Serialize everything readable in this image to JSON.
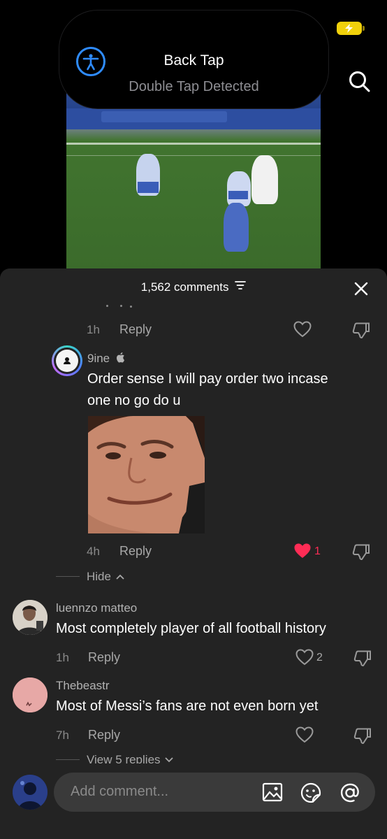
{
  "status": {
    "battery": "charging"
  },
  "notification": {
    "title": "Back Tap",
    "subtitle": "Double Tap Detected"
  },
  "comments_sheet": {
    "header": "1,562 comments",
    "comments": [
      {
        "time": "1h",
        "reply_label": "Reply"
      },
      {
        "user": "9ine",
        "text_line1": "Order sense I will pay order two incase",
        "text_line2": "one no go do u",
        "time": "4h",
        "reply_label": "Reply",
        "likes": "1",
        "liked": true
      },
      {
        "hide_label": "Hide"
      },
      {
        "user": "luennzo matteo",
        "text": "Most completely player of all football history",
        "time": "1h",
        "reply_label": "Reply",
        "likes": "2"
      },
      {
        "user": "Thebeastr",
        "text": "Most of Messi’s fans are not even born yet",
        "time": "7h",
        "reply_label": "Reply",
        "view_replies": "View 5 replies"
      }
    ]
  },
  "input": {
    "placeholder": "Add comment..."
  },
  "colors": {
    "accent_blue": "#2f8cff",
    "like_red": "#fe2c55",
    "battery_yellow": "#f1d10b"
  }
}
